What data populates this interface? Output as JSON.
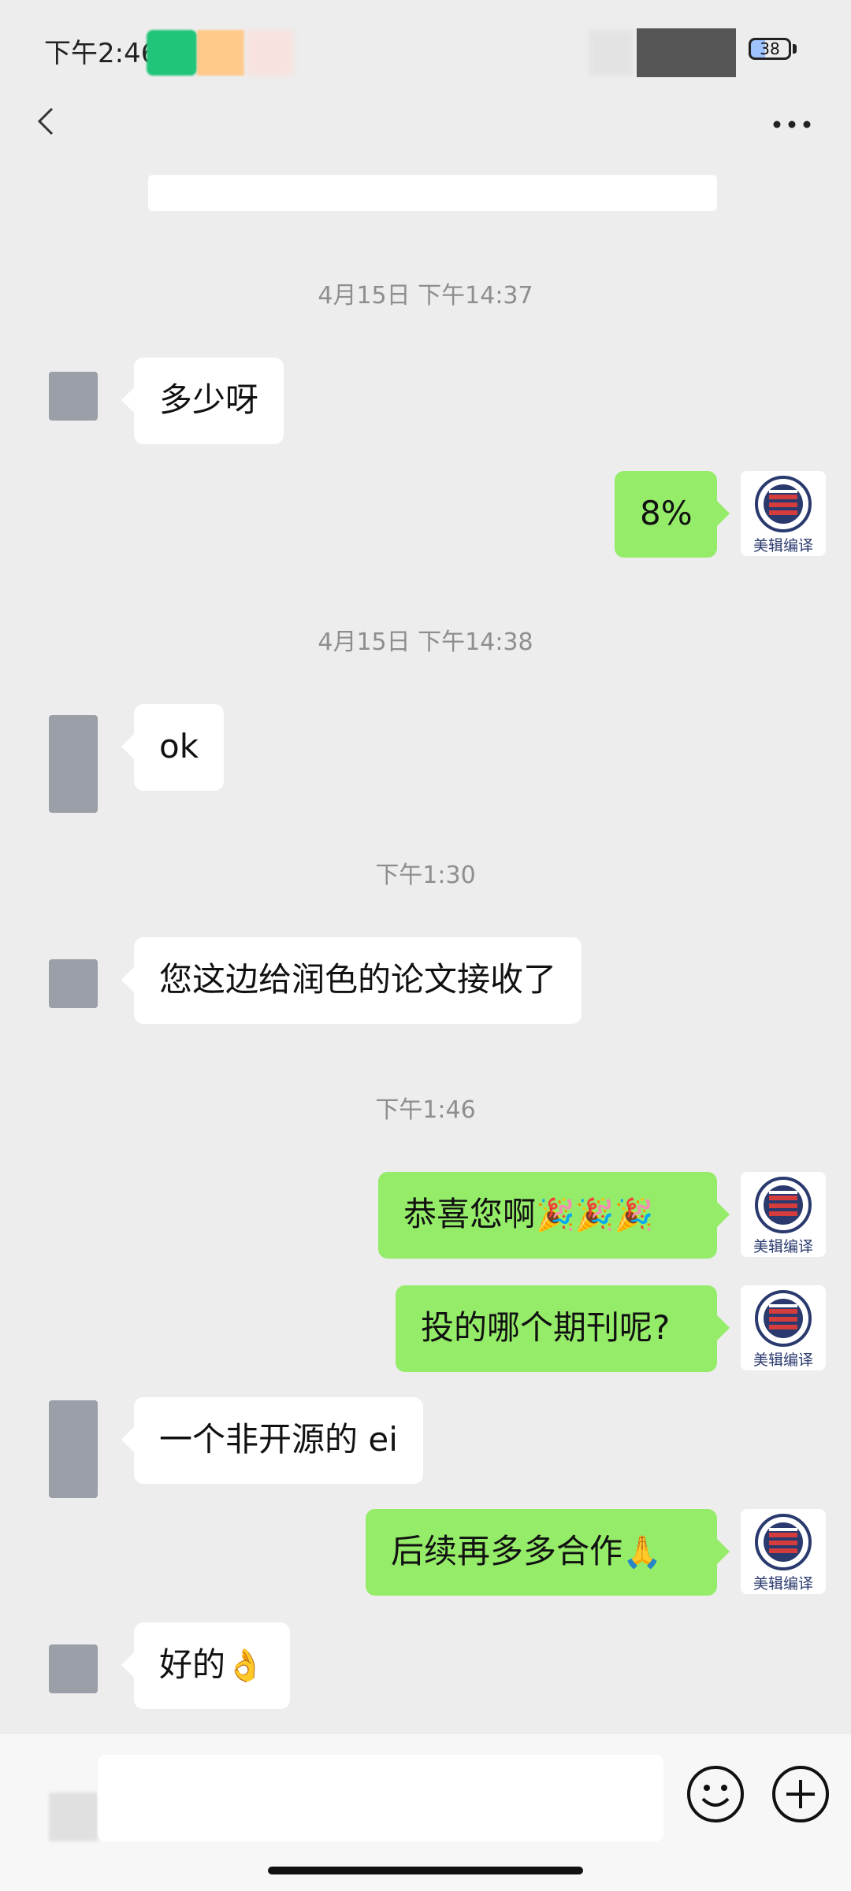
{
  "status_bar": {
    "time": "下午2:46",
    "battery": "38"
  },
  "messages": {
    "ts1": "4月15日 下午14:37",
    "m1": "多少呀",
    "m2": "8%",
    "ts2": "4月15日 下午14:38",
    "m3": "ok",
    "ts3": "下午1:30",
    "m4": "您这边给润色的论文接收了",
    "ts4": "下午1:46",
    "m5": "恭喜您啊",
    "m5_emoji": "🎉🎉🎉",
    "m6": "投的哪个期刊呢?",
    "m7": "一个非开源的 ei",
    "m8": "后续再多多合作",
    "m8_emoji": "🙏",
    "m9": "好的",
    "m9_emoji": "👌"
  },
  "logo": {
    "caption": "美辑编译"
  },
  "icons": {
    "back": "chevron-left-icon",
    "more": "more-icon",
    "emoji": "smiley-icon",
    "plus": "plus-circle-icon"
  },
  "colors": {
    "outgoing_bubble": "#95ec69",
    "incoming_bubble": "#ffffff",
    "background": "#ededed"
  }
}
